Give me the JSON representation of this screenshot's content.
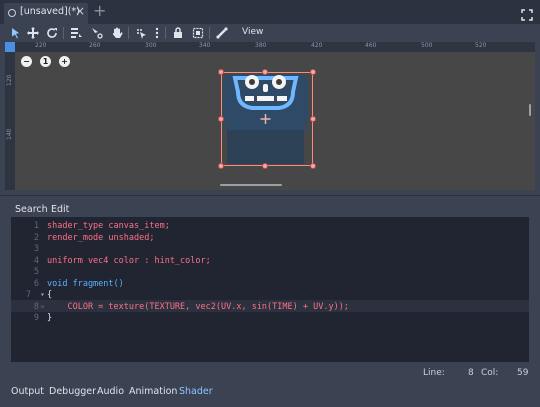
{
  "tab": {
    "label": "[unsaved](*)",
    "close": "×",
    "add": "+"
  },
  "toolbar": {
    "icons": [
      "select-icon",
      "move-icon",
      "rotate-icon",
      "list-icon",
      "pivot-icon",
      "pan-icon",
      "snap-icon",
      "more-icon",
      "lock-icon",
      "group-icon",
      "bone-icon"
    ],
    "view_label": "View"
  },
  "viewport": {
    "ruler_top": [
      "220",
      "240",
      "260",
      "280",
      "300",
      "320",
      "340",
      "360",
      "380",
      "400",
      "420",
      "440",
      "460",
      "480",
      "500",
      "520"
    ],
    "ruler_left": [
      "120",
      "140",
      "160"
    ],
    "zoom": {
      "out": "−",
      "reset": "1",
      "in": "+"
    }
  },
  "shader_menu": {
    "search": "Search",
    "edit": "Edit"
  },
  "code": {
    "line_numbers": [
      "1",
      "2",
      "3",
      "4",
      "5",
      "6",
      "7",
      "8",
      "9"
    ],
    "lines": [
      "shader_type canvas_item;",
      "render_mode unshaded;",
      "",
      "uniform vec4 color : hint_color;",
      "",
      "void fragment()",
      "{",
      "    COLOR = texture(TEXTURE, vec2(UV.x, sin(TIME) + UV.y));",
      "}"
    ]
  },
  "status": {
    "line_label": "Line:",
    "line_value": "8",
    "col_label": "Col:",
    "col_value": "59"
  },
  "bottom_tabs": [
    "Output",
    "Debugger",
    "Audio",
    "Animation",
    "Shader"
  ],
  "colors": {
    "accent": "#8fc6ff",
    "keyword": "#ff7085",
    "type": "#42ffc2",
    "function": "#57b3ff"
  }
}
